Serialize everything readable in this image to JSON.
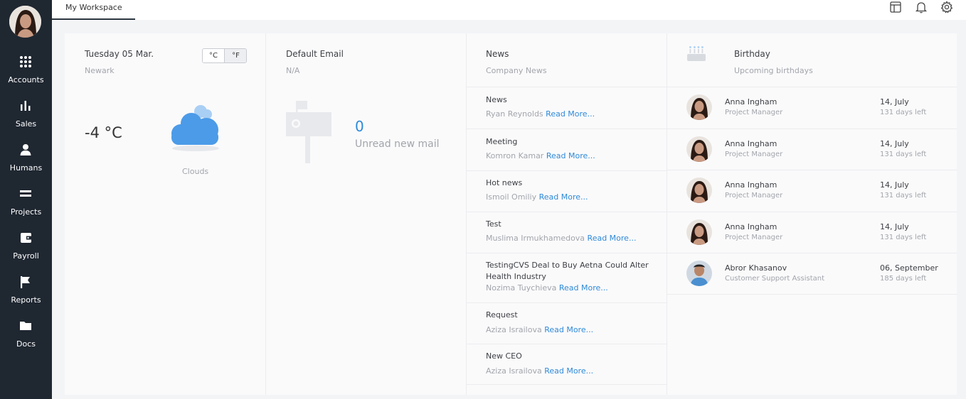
{
  "sidebar": {
    "items": [
      {
        "label": "Accounts",
        "icon": "grid-dots-icon"
      },
      {
        "label": "Sales",
        "icon": "bar-chart-icon"
      },
      {
        "label": "Humans",
        "icon": "person-icon"
      },
      {
        "label": "Projects",
        "icon": "equals-icon"
      },
      {
        "label": "Payroll",
        "icon": "wallet-icon"
      },
      {
        "label": "Reports",
        "icon": "flag-icon"
      },
      {
        "label": "Docs",
        "icon": "folder-icon"
      }
    ]
  },
  "topbar": {
    "tab_label": "My Workspace",
    "icons": [
      "layout-icon",
      "bell-icon",
      "gear-icon"
    ]
  },
  "weather": {
    "date": "Tuesday 05 Mar.",
    "location": "Newark",
    "unit_c": "°C",
    "unit_f": "°F",
    "temperature": "-4 °C",
    "condition": "Clouds"
  },
  "email": {
    "title": "Default Email",
    "account": "N/A",
    "unread_count": "0",
    "unread_label": "Unread new mail"
  },
  "news": {
    "title": "News",
    "subtitle": "Company News",
    "read_more": "Read More...",
    "items": [
      {
        "title": "News",
        "author": "Ryan Reynolds"
      },
      {
        "title": "Meeting",
        "author": "Komron Kamar"
      },
      {
        "title": "Hot news",
        "author": "Ismoil Omiliy"
      },
      {
        "title": "Test",
        "author": "Muslima Irmukhamedova"
      },
      {
        "title": "TestingCVS Deal to Buy Aetna Could Alter Health Industry",
        "author": "Nozima Tuychieva"
      },
      {
        "title": "Request",
        "author": "Aziza Israilova"
      },
      {
        "title": "New CEO",
        "author": "Aziza Israilova"
      }
    ]
  },
  "birthday": {
    "title": "Birthday",
    "subtitle": "Upcoming birthdays",
    "people": [
      {
        "name": "Anna Ingham",
        "role": "Project Manager",
        "date": "14, July",
        "days_left": "131 days left"
      },
      {
        "name": "Anna Ingham",
        "role": "Project Manager",
        "date": "14, July",
        "days_left": "131 days left"
      },
      {
        "name": "Anna Ingham",
        "role": "Project Manager",
        "date": "14, July",
        "days_left": "131 days left"
      },
      {
        "name": "Anna Ingham",
        "role": "Project Manager",
        "date": "14, July",
        "days_left": "131 days left"
      },
      {
        "name": "Abror Khasanov",
        "role": "Customer Support Assistant",
        "date": "06, September",
        "days_left": "185 days left"
      }
    ]
  },
  "colors": {
    "sidebar_bg": "#1f2731",
    "accent_link": "#2f8ad8",
    "cloud": "#4c9be8"
  }
}
